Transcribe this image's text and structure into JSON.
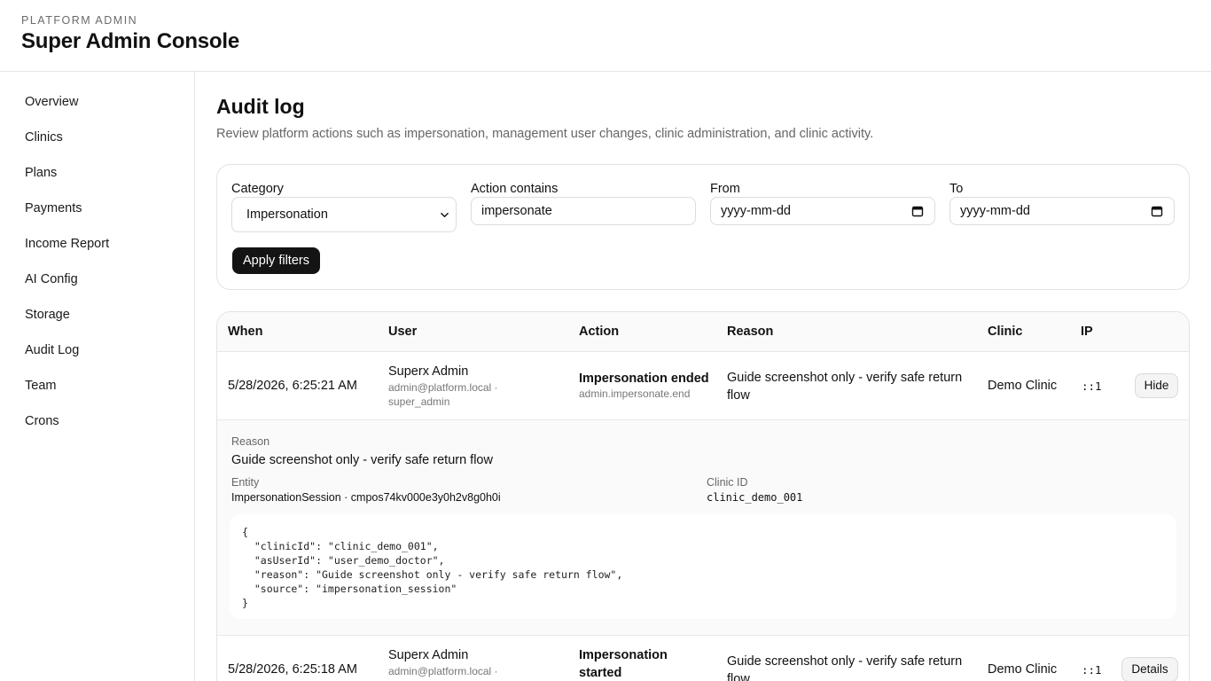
{
  "header": {
    "eyebrow": "PLATFORM ADMIN",
    "title": "Super Admin Console"
  },
  "sidebar": {
    "items": [
      {
        "label": "Overview"
      },
      {
        "label": "Clinics"
      },
      {
        "label": "Plans"
      },
      {
        "label": "Payments"
      },
      {
        "label": "Income Report"
      },
      {
        "label": "AI Config"
      },
      {
        "label": "Storage"
      },
      {
        "label": "Audit Log"
      },
      {
        "label": "Team"
      },
      {
        "label": "Crons"
      }
    ]
  },
  "page": {
    "title": "Audit log",
    "description": "Review platform actions such as impersonation, management user changes, clinic administration, and clinic activity."
  },
  "filters": {
    "category_label": "Category",
    "category_value": "Impersonation",
    "action_label": "Action contains",
    "action_value": "impersonate",
    "from_label": "From",
    "from_placeholder": "yyyy-mm-dd",
    "to_label": "To",
    "to_placeholder": "yyyy-mm-dd",
    "apply_label": "Apply filters"
  },
  "table": {
    "columns": [
      "When",
      "User",
      "Action",
      "Reason",
      "Clinic",
      "IP"
    ],
    "rows": [
      {
        "when": "5/28/2026, 6:25:21 AM",
        "user_name": "Superx Admin",
        "user_email": "admin@platform.local ·",
        "user_role": "super_admin",
        "action_title": "Impersonation ended",
        "action_code": "admin.impersonate.end",
        "reason_line1": "Guide screenshot only - verify safe return",
        "reason_line2": "flow",
        "clinic": "Demo Clinic",
        "ip": "::1",
        "button": "Hide"
      },
      {
        "when": "5/28/2026, 6:25:18 AM",
        "user_name": "Superx Admin",
        "user_email": "admin@platform.local ·",
        "action_title_line1": "Impersonation",
        "action_title_line2": "started",
        "reason_line1": "Guide screenshot only - verify safe return",
        "reason_line2": "flow",
        "clinic": "Demo Clinic",
        "ip": "::1",
        "button": "Details"
      }
    ],
    "detail": {
      "reason_label": "Reason",
      "reason_value": "Guide screenshot only - verify safe return flow",
      "entity_label": "Entity",
      "entity_value": "ImpersonationSession · cmpos74kv000e3y0h2v8g0h0i",
      "clinic_id_label": "Clinic ID",
      "clinic_id_value": "clinic_demo_001",
      "json_lines": [
        "{",
        "  \"clinicId\": \"clinic_demo_001\",",
        "  \"asUserId\": \"user_demo_doctor\",",
        "  \"reason\": \"Guide screenshot only - verify safe return flow\",",
        "  \"source\": \"impersonation_session\"",
        "}"
      ]
    }
  }
}
